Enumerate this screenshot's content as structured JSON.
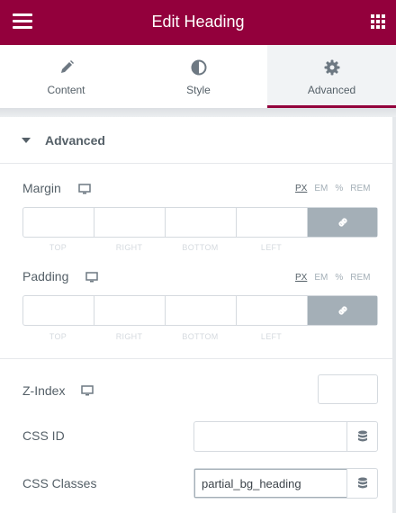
{
  "header": {
    "title": "Edit Heading",
    "menu_icon": "hamburger-icon",
    "apps_icon": "grid-icon",
    "background": "#93003c"
  },
  "tabs": [
    {
      "label": "Content",
      "icon": "pencil-icon",
      "active": false
    },
    {
      "label": "Style",
      "icon": "half-circle-icon",
      "active": false
    },
    {
      "label": "Advanced",
      "icon": "gear-icon",
      "active": true
    }
  ],
  "section": {
    "title": "Advanced",
    "icon": "caret-down-icon"
  },
  "margin": {
    "label": "Margin",
    "units": [
      "PX",
      "EM",
      "%",
      "REM"
    ],
    "selected_unit": "PX",
    "sides": [
      "TOP",
      "RIGHT",
      "BOTTOM",
      "LEFT"
    ]
  },
  "padding": {
    "label": "Padding",
    "units": [
      "PX",
      "EM",
      "%",
      "REM"
    ],
    "selected_unit": "PX",
    "sides": [
      "TOP",
      "RIGHT",
      "BOTTOM",
      "LEFT"
    ]
  },
  "z_index": {
    "label": "Z-Index",
    "value": ""
  },
  "css_id": {
    "label": "CSS ID",
    "value": ""
  },
  "css_classes": {
    "label": "CSS Classes",
    "value": "partial_bg_heading"
  }
}
